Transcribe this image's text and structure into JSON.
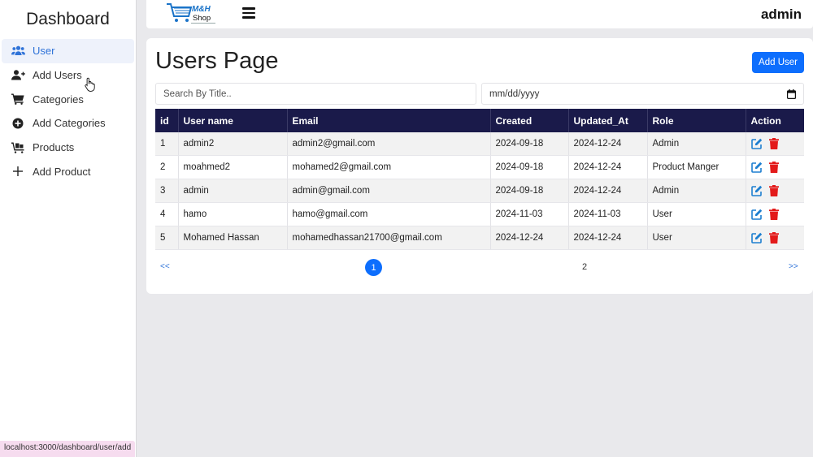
{
  "sidebar": {
    "title": "Dashboard",
    "items": [
      {
        "label": "User",
        "icon": "users-icon",
        "active": true
      },
      {
        "label": "Add Users",
        "icon": "user-plus-icon"
      },
      {
        "label": "Categories",
        "icon": "cart-icon"
      },
      {
        "label": "Add Categories",
        "icon": "plus-circle-icon"
      },
      {
        "label": "Products",
        "icon": "cart-flatbed-icon"
      },
      {
        "label": "Add Product",
        "icon": "plus-icon"
      }
    ]
  },
  "header": {
    "logo_text": "M&H",
    "logo_subtext": "Shop",
    "user_name": "admin"
  },
  "main": {
    "title": "Users Page",
    "add_button": "Add User",
    "search_placeholder": "Search By Title..",
    "date_placeholder": "mm/dd/yyyy"
  },
  "table": {
    "columns": [
      "id",
      "User name",
      "Email",
      "Created",
      "Updated_At",
      "Role",
      "Action"
    ],
    "rows": [
      {
        "id": "1",
        "name": "admin2",
        "email": "admin2@gmail.com",
        "created": "2024-09-18",
        "updated": "2024-12-24",
        "role": "Admin"
      },
      {
        "id": "2",
        "name": "moahmed2",
        "email": "mohamed2@gmail.com",
        "created": "2024-09-18",
        "updated": "2024-12-24",
        "role": "Product Manger"
      },
      {
        "id": "3",
        "name": "admin",
        "email": "admin@gmail.com",
        "created": "2024-09-18",
        "updated": "2024-12-24",
        "role": "Admin"
      },
      {
        "id": "4",
        "name": "hamo",
        "email": "hamo@gmail.com",
        "created": "2024-11-03",
        "updated": "2024-11-03",
        "role": "User"
      },
      {
        "id": "5",
        "name": "Mohamed Hassan",
        "email": "mohamedhassan21700@gmail.com",
        "created": "2024-12-24",
        "updated": "2024-12-24",
        "role": "User"
      }
    ]
  },
  "pagination": {
    "prev": "<<",
    "pages": [
      "1",
      "2"
    ],
    "current": "1",
    "next": ">>"
  },
  "statusbar": {
    "url": "localhost:3000/dashboard/user/add"
  },
  "colors": {
    "accent": "#0d6efd",
    "table_header": "#1a1a4a",
    "edit_icon": "#1e7fd0",
    "delete_icon": "#e31b1b"
  }
}
